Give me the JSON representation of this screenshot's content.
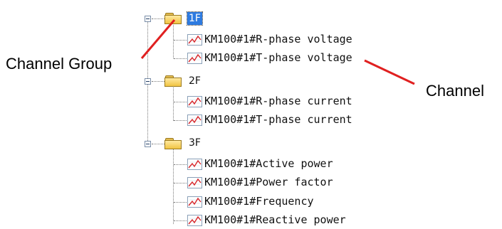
{
  "tree": {
    "groups": [
      {
        "label": "1F",
        "channels": [
          "KM100#1#R-phase voltage",
          "KM100#1#T-phase voltage"
        ]
      },
      {
        "label": "2F",
        "channels": [
          "KM100#1#R-phase current",
          "KM100#1#T-phase current"
        ]
      },
      {
        "label": "3F",
        "channels": [
          "KM100#1#Active power",
          "KM100#1#Power factor",
          "KM100#1#Frequency",
          "KM100#1#Reactive power"
        ]
      }
    ]
  },
  "annotations": {
    "channel_group": "Channel Group",
    "channel": "Channel"
  },
  "colors": {
    "selection": "#2e7be0",
    "arrow": "#e02020",
    "folder": "#f1c443"
  },
  "icons": {
    "toggle": "collapse-minus-icon",
    "group": "folder-icon",
    "channel": "trend-chart-icon"
  }
}
